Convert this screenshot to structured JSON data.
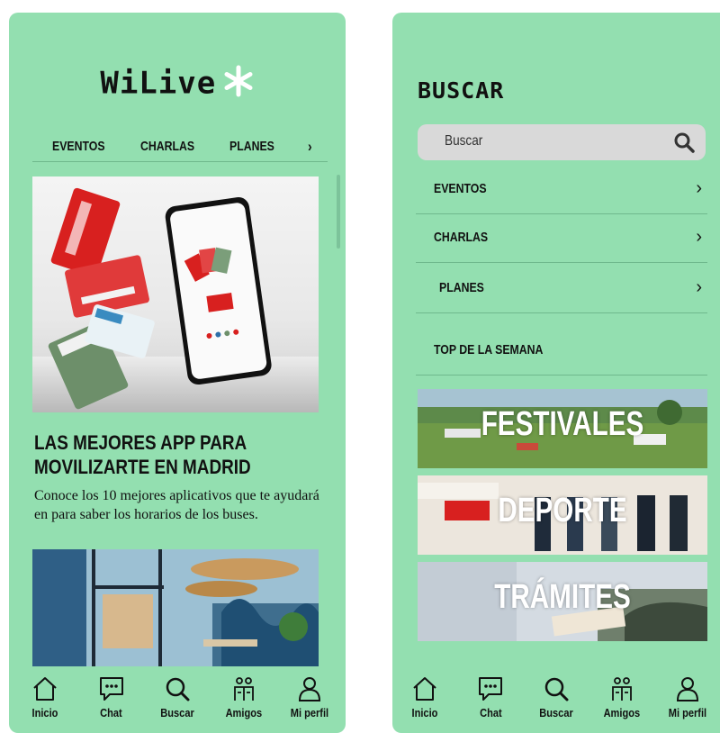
{
  "left": {
    "logo": "WiLive",
    "tabs": [
      "EVENTOS",
      "CHARLAS",
      "PLANES"
    ],
    "tab_next": "›",
    "article": {
      "title": "LAS MEJORES APP PARA MOVILIZARTE EN MADRID",
      "description": "Conoce los 10 mejores aplicativos que te ayudará en para saber los horarios de los buses."
    }
  },
  "right": {
    "title": "BUSCAR",
    "search": {
      "placeholder": "Buscar"
    },
    "categories": [
      {
        "label": "EVENTOS"
      },
      {
        "label": "CHARLAS"
      },
      {
        "label": "PLANES"
      }
    ],
    "top_section": "TOP DE LA SEMANA",
    "banners": [
      "FESTIVALES",
      "DEPORTE",
      "TRÁMITES"
    ]
  },
  "nav": {
    "items": [
      {
        "label": "Inicio",
        "icon": "home-icon"
      },
      {
        "label": "Chat",
        "icon": "chat-icon"
      },
      {
        "label": "Buscar",
        "icon": "search-icon"
      },
      {
        "label": "Amigos",
        "icon": "friends-icon"
      },
      {
        "label": "Mi perfil",
        "icon": "profile-icon"
      }
    ]
  },
  "colors": {
    "screen_bg": "#93dfb0",
    "accent_red": "#d8201f",
    "divider": "#6fb98d"
  }
}
